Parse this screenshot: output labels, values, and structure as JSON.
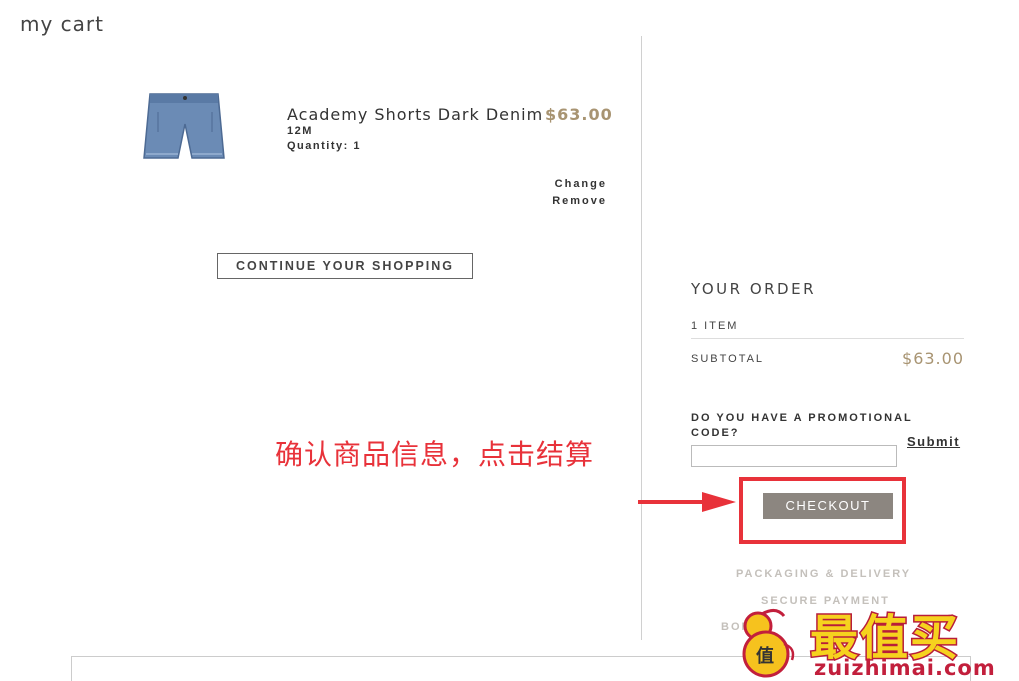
{
  "page": {
    "title": "my cart"
  },
  "cart": {
    "item": {
      "name": "Academy Shorts Dark Denim",
      "price": "$63.00",
      "size": "12M",
      "quantity_label": "Quantity: 1",
      "change_label": "Change",
      "remove_label": "Remove",
      "image_icon": "denim-shorts-image"
    },
    "continue_label": "CONTINUE YOUR SHOPPING"
  },
  "order": {
    "title": "YOUR ORDER",
    "item_count": "1 ITEM",
    "subtotal_label": "SUBTOTAL",
    "subtotal_value": "$63.00",
    "promo_label": "DO YOU HAVE A PROMOTIONAL CODE?",
    "promo_value": "",
    "submit_label": "Submit",
    "checkout_label": "CHECKOUT",
    "info_links": [
      "PACKAGING & DELIVERY",
      "SECURE PAYMENT",
      "BONUS"
    ]
  },
  "annotation": {
    "text": "确认商品信息，点击结算",
    "color": "#e8323a"
  },
  "watermark": {
    "chars": "最值买",
    "url": "zuizhimai.com",
    "mascot_label": "值"
  },
  "colors": {
    "accent_price": "#a89472",
    "checkout_bg": "#8c8680",
    "highlight": "#e8323a"
  }
}
